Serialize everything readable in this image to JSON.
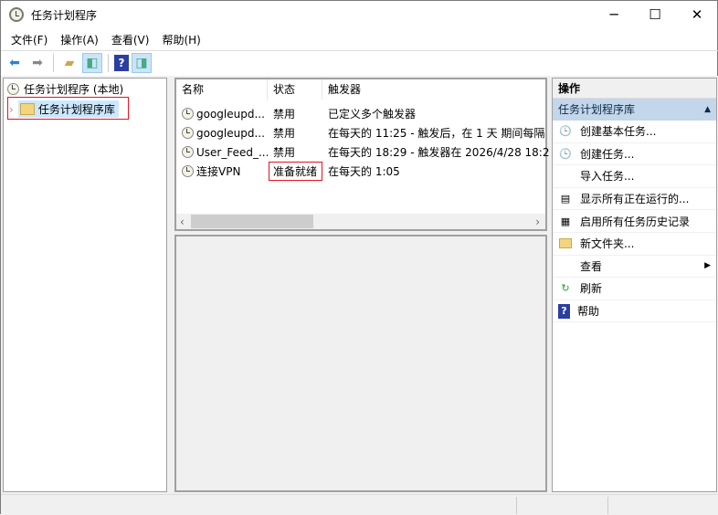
{
  "window": {
    "title": "任务计划程序",
    "minimize": "─",
    "maximize": "☐",
    "close": "✕"
  },
  "menu": [
    "文件(F)",
    "操作(A)",
    "查看(V)",
    "帮助(H)"
  ],
  "toolbar": {
    "icons": [
      "back-arrow-icon",
      "forward-arrow-icon",
      "up-folder-icon",
      "show-hide-console-tree-icon",
      "help-icon",
      "show-hide-action-pane-icon"
    ]
  },
  "tree": {
    "root": "任务计划程序 (本地)",
    "child": "任务计划程序库"
  },
  "list": {
    "columns": [
      "名称",
      "状态",
      "触发器"
    ],
    "rows": [
      {
        "name": "googleupd...",
        "status": "禁用",
        "trigger": "已定义多个触发器"
      },
      {
        "name": "googleupd...",
        "status": "禁用",
        "trigger": "在每天的 11:25 - 触发后，在 1 天 期间每隔"
      },
      {
        "name": "User_Feed_...",
        "status": "禁用",
        "trigger": "在每天的 18:29 - 触发器在 2026/4/28 18:2"
      },
      {
        "name": "连接VPN",
        "status": "准备就绪",
        "trigger": "在每天的 1:05"
      }
    ]
  },
  "actions": {
    "header": "操作",
    "section": "任务计划程序库",
    "items": [
      {
        "label": "创建基本任务...",
        "icon": "create-basic-task-icon"
      },
      {
        "label": "创建任务...",
        "icon": "create-task-icon"
      },
      {
        "label": "导入任务...",
        "icon": ""
      },
      {
        "label": "显示所有正在运行的...",
        "icon": "running-tasks-icon"
      },
      {
        "label": "启用所有任务历史记录",
        "icon": "history-icon"
      },
      {
        "label": "新文件夹...",
        "icon": "new-folder-icon"
      },
      {
        "label": "查看",
        "icon": ""
      },
      {
        "label": "刷新",
        "icon": "refresh-icon"
      },
      {
        "label": "帮助",
        "icon": "help-icon"
      }
    ]
  },
  "colors": {
    "highlight_box": "#e81123",
    "selection": "#cce8ff",
    "section_bg": "#c3d6ea"
  }
}
